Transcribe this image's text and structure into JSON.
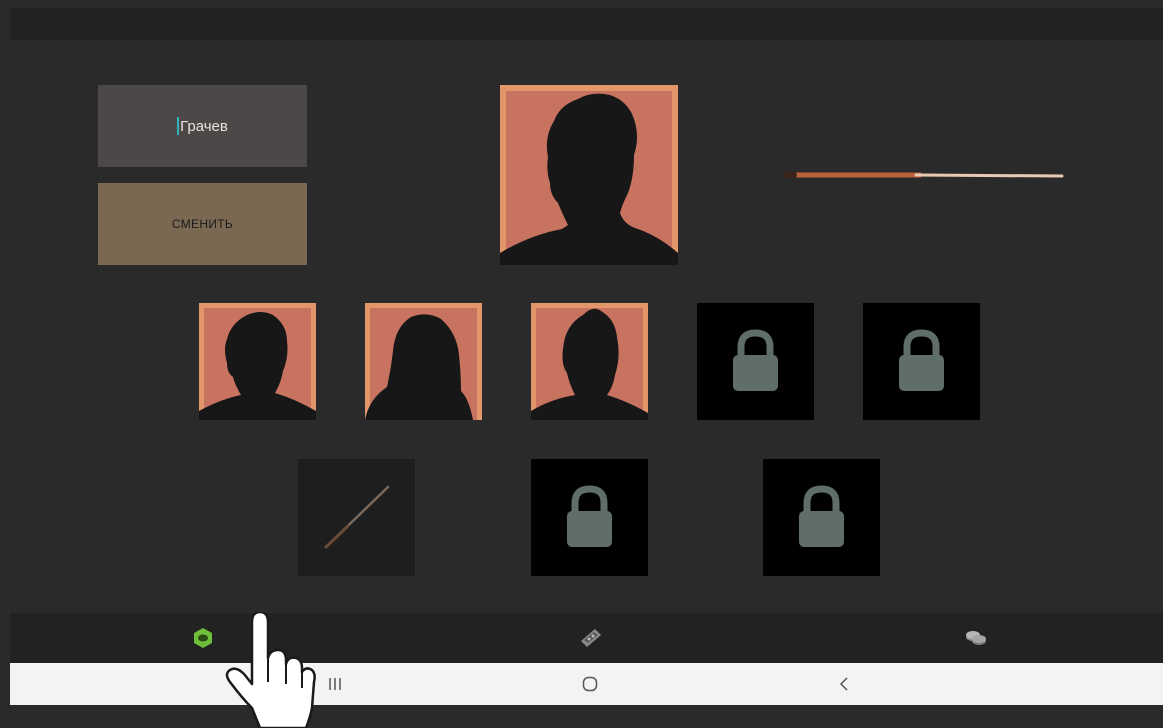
{
  "profile": {
    "player_name": "Грачев",
    "change_button_label": "СМЕНИТЬ",
    "selected_avatar": "avatar-man"
  },
  "avatars": [
    {
      "icon": "avatar-man-silhouette",
      "locked": false
    },
    {
      "icon": "avatar-woman-long-hair-silhouette",
      "locked": false
    },
    {
      "icon": "avatar-woman-bangs-silhouette",
      "locked": false
    },
    {
      "icon": "lock-icon",
      "locked": true
    },
    {
      "icon": "lock-icon",
      "locked": true
    }
  ],
  "cues": [
    {
      "icon": "cue-stick-icon",
      "locked": false
    },
    {
      "icon": "lock-icon",
      "locked": true
    },
    {
      "icon": "lock-icon",
      "locked": true
    }
  ],
  "bottom_nav": [
    {
      "icon": "nut-settings-icon",
      "active": true
    },
    {
      "icon": "billiard-table-icon",
      "active": false
    },
    {
      "icon": "coins-icon",
      "active": false
    }
  ],
  "system_nav": [
    {
      "icon": "recent-apps-icon"
    },
    {
      "icon": "home-icon"
    },
    {
      "icon": "back-icon"
    }
  ],
  "colors": {
    "background": "#2a2a2a",
    "avatar_bg": "#c87360",
    "avatar_border": "#e3966a",
    "lock_fill": "#5f6e66",
    "change_button": "#7b6853",
    "name_field": "#4c4848",
    "active_nav": "#6fbf3a"
  }
}
